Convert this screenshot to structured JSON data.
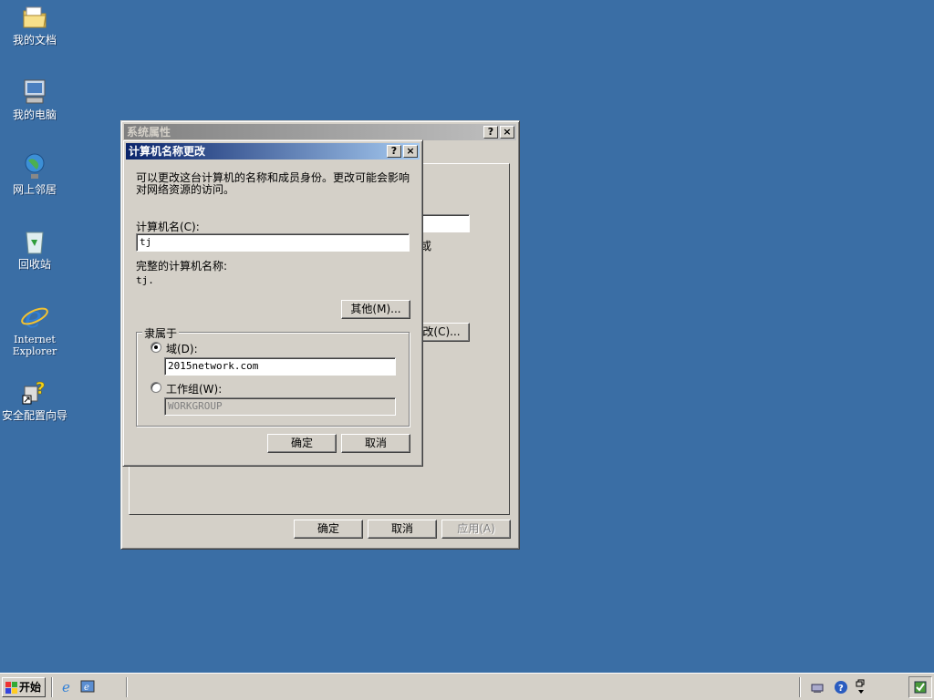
{
  "desktop": {
    "icons": [
      {
        "label": "我的文档"
      },
      {
        "label": "我的电脑"
      },
      {
        "label": "网上邻居"
      },
      {
        "label": "回收站"
      },
      {
        "label": "Internet Explorer"
      },
      {
        "label": "安全配置向导"
      }
    ]
  },
  "sysprops": {
    "title": "系统属性",
    "help": "?",
    "close": "×",
    "behind_text_1": "或",
    "behind_button": "改(C)...",
    "ok": "确定",
    "cancel": "取消",
    "apply": "应用(A)"
  },
  "rename": {
    "title": "计算机名称更改",
    "help": "?",
    "close": "×",
    "description_line1": "可以更改这台计算机的名称和成员身份。更改可能会影响",
    "description_line2": "对网络资源的访问。",
    "computer_name_label": "计算机名(C):",
    "computer_name_value": "tj",
    "full_name_label": "完整的计算机名称:",
    "full_name_value": "tj.",
    "more_button": "其他(M)...",
    "member_of": "隶属于",
    "domain_label": "域(D):",
    "domain_value": "2015network.com",
    "workgroup_label": "工作组(W):",
    "workgroup_value": "WORKGROUP",
    "ok": "确定",
    "cancel": "取消"
  },
  "taskbar": {
    "start": "开始"
  },
  "colors": {
    "desktop": "#3a6ea5",
    "active_title": "#0a246a",
    "face": "#d4d0c8"
  }
}
